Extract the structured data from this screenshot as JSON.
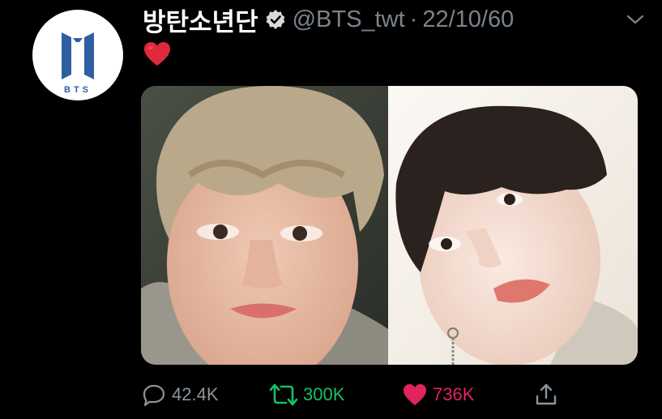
{
  "tweet": {
    "display_name": "방탄소년단",
    "handle": "@BTS_twt",
    "separator": "·",
    "date": "22/10/60",
    "text": "❤️",
    "verified": true
  },
  "avatar": {
    "logo_text": "BTS",
    "logo_color": "#2f5fa0"
  },
  "media": {
    "photos": [
      {
        "subject": "person-with-light-brown-hair"
      },
      {
        "subject": "person-with-dark-hair"
      }
    ]
  },
  "actions": {
    "reply_count": "42.4K",
    "retweet_count": "300K",
    "like_count": "736K"
  },
  "colors": {
    "background": "#000000",
    "secondary_text": "#7b838b",
    "retweet_green": "#17bf63",
    "like_red": "#e0245e"
  }
}
